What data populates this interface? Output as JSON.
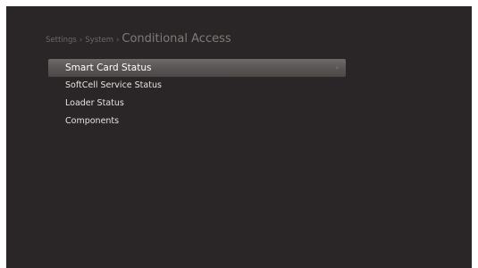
{
  "breadcrumb": {
    "items": [
      "Settings",
      "System"
    ],
    "separator": "›",
    "current": "Conditional Access"
  },
  "menu": {
    "items": [
      {
        "label": "Smart Card Status",
        "selected": true
      },
      {
        "label": "SoftCell Service Status",
        "selected": false
      },
      {
        "label": "Loader Status",
        "selected": false
      },
      {
        "label": "Components",
        "selected": false
      }
    ],
    "selected_indicator": "›"
  },
  "colors": {
    "background": "#2a2526",
    "highlight": "#5a5655",
    "text": "#e7e3e1"
  }
}
